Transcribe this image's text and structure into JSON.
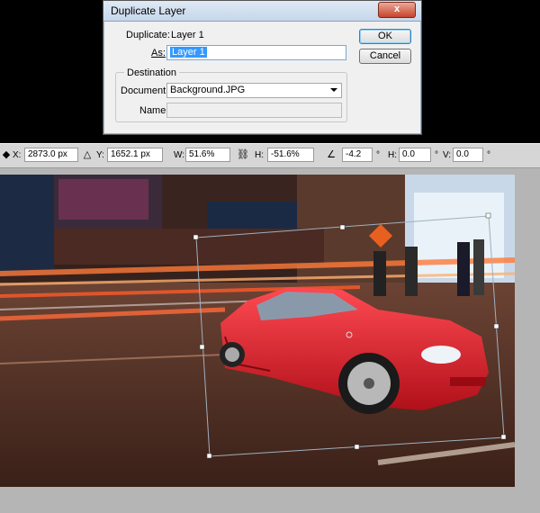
{
  "dialog": {
    "title": "Duplicate Layer",
    "close_label": "x",
    "duplicate_label": "Duplicate:",
    "duplicate_value": "Layer 1",
    "as_label": "As:",
    "as_value": "Layer 1",
    "ok_label": "OK",
    "cancel_label": "Cancel",
    "destination_legend": "Destination",
    "document_label": "Document:",
    "document_value": "Background.JPG",
    "name_label": "Name:",
    "name_value": ""
  },
  "options_bar": {
    "x_label": "X:",
    "x_value": "2873.0 px",
    "y_label": "Y:",
    "y_value": "1652.1 px",
    "w_label": "W:",
    "w_value": "51.6%",
    "h_label": "H:",
    "h_value": "-51.6%",
    "rotate_value": "-4.2",
    "degree_symbol": "°",
    "hskew_label": "H:",
    "hskew_value": "0.0",
    "vskew_label": "V:",
    "vskew_value": "0.0",
    "delta_icon": "delta-icon",
    "link_icon": "chain-link-icon",
    "angle_icon": "angle-icon"
  },
  "canvas": {
    "image_description_icons": [
      "street-scene",
      "red-car-layer"
    ]
  },
  "colors": {
    "car_red": "#e01a24",
    "light_streak": "#ff6a2a",
    "dialog_bg": "#f0f0f0"
  }
}
